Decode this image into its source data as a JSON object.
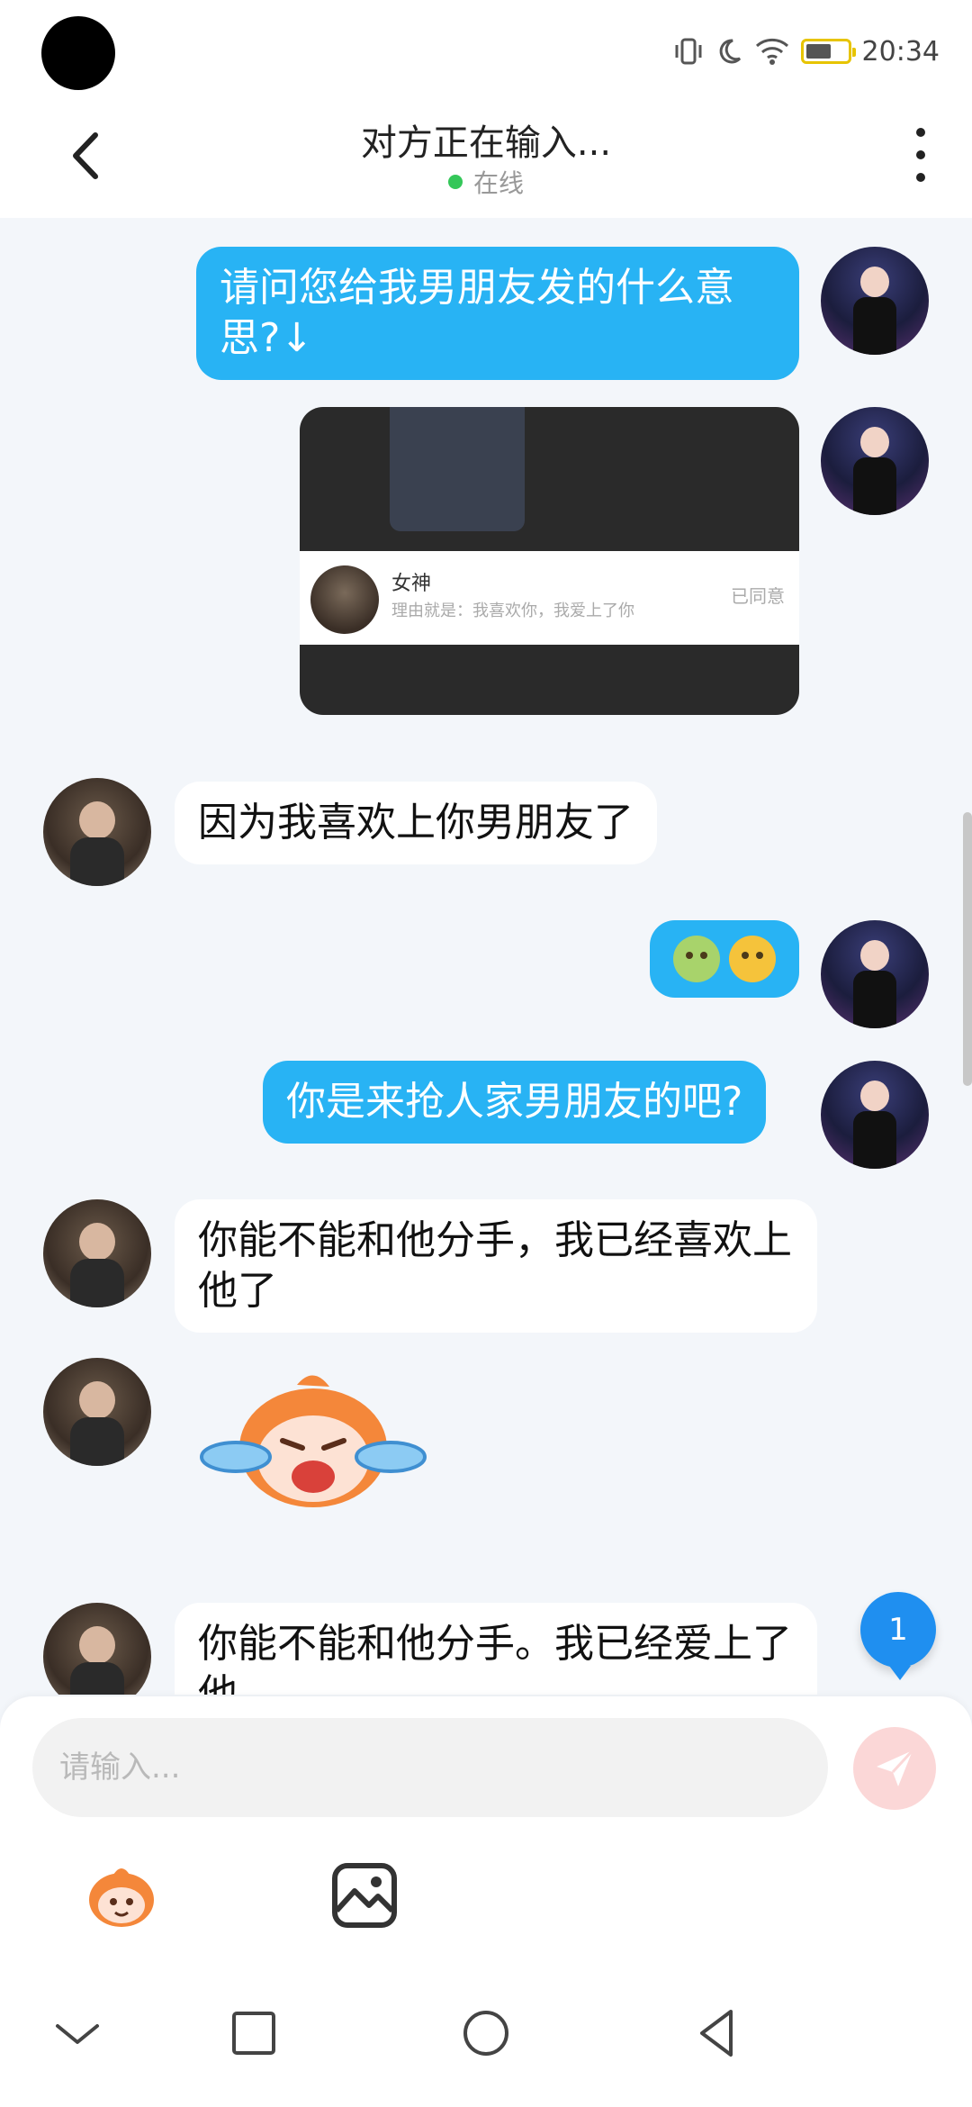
{
  "status_bar": {
    "time": "20:34",
    "icons": [
      "vibrate-icon",
      "moon-icon",
      "wifi-icon",
      "battery-icon"
    ]
  },
  "header": {
    "title": "对方正在输入...",
    "status": "在线",
    "status_color": "#34c759",
    "back_icon": "chevron-left-icon",
    "menu_icon": "more-vertical-icon"
  },
  "messages": [
    {
      "from": "me",
      "type": "text",
      "text": "请问您给我男朋友发的什么意思?↓"
    },
    {
      "from": "me",
      "type": "image",
      "card": {
        "name": "女神",
        "reason": "理由就是：我喜欢你，我爱上了你",
        "status": "已同意"
      }
    },
    {
      "from": "other",
      "type": "text",
      "text": "因为我喜欢上你男朋友了"
    },
    {
      "from": "me",
      "type": "emoji",
      "emojis": [
        "nauseated-face",
        "vomiting-face"
      ]
    },
    {
      "from": "me",
      "type": "text",
      "text": "你是来抢人家男朋友的吧?"
    },
    {
      "from": "other",
      "type": "text",
      "text": "你能不能和他分手，我已经喜欢上他了"
    },
    {
      "from": "other",
      "type": "sticker",
      "sticker": "crying-monkey-sticker"
    },
    {
      "from": "other",
      "type": "text",
      "text": "你能不能和他分手。我已经爱上了他"
    }
  ],
  "unread_badge": "1",
  "composer": {
    "placeholder": "请输入...",
    "send_icon": "send-icon",
    "tools": [
      "sticker-icon",
      "image-icon"
    ]
  },
  "nav": [
    "collapse-icon",
    "recents-icon",
    "home-icon",
    "back-icon"
  ],
  "colors": {
    "my_bubble": "#28b3f4",
    "other_bubble": "#ffffff",
    "background": "#f3f6fa",
    "badge": "#1f8ff0"
  }
}
